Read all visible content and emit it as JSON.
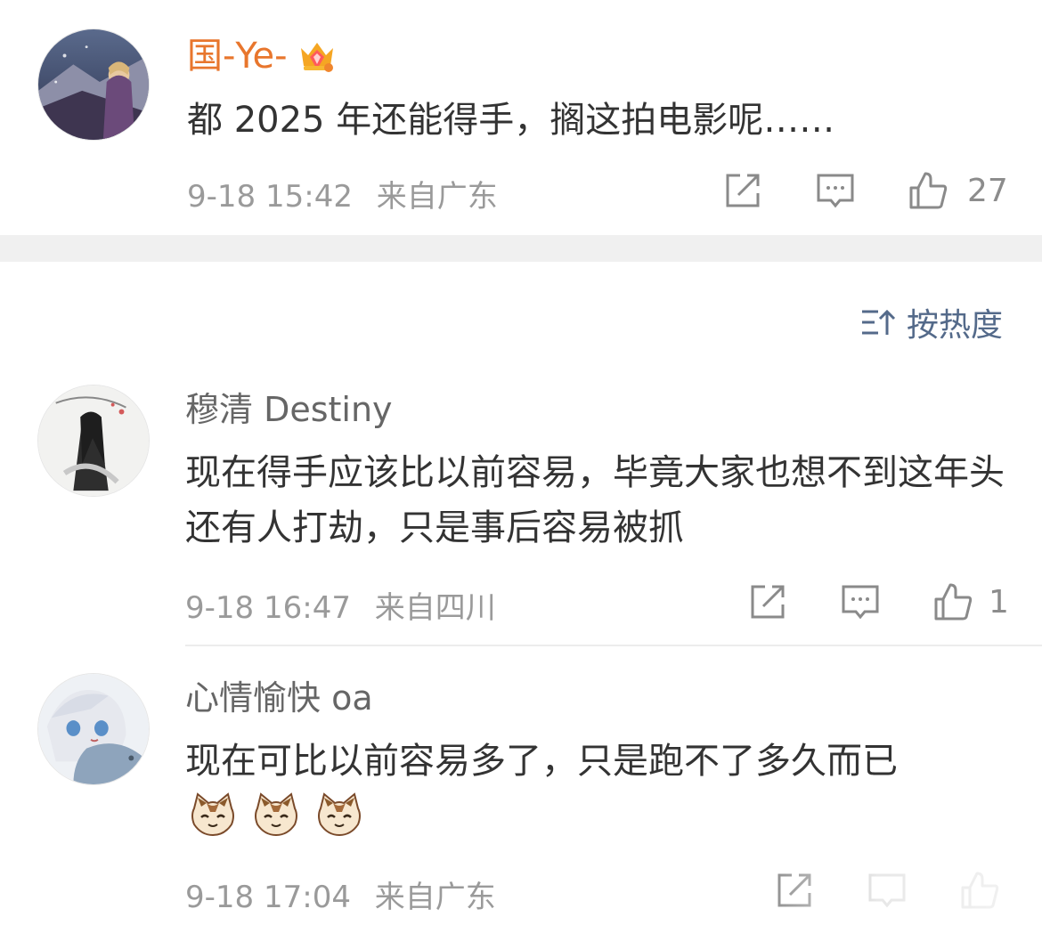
{
  "top_comment": {
    "username": "国-Ye-",
    "badge_icon": "crown-badge-icon",
    "text": "都 2025 年还能得手，搁这拍电影呢……",
    "time": "9-18 15:42",
    "location": "来自广东",
    "likes": "27",
    "username_color": "#e8762d"
  },
  "sort": {
    "label": "按热度",
    "icon": "sort-icon",
    "color": "#546a8a"
  },
  "replies": [
    {
      "username": "穆清 Destiny",
      "text": "现在得手应该比以前容易，毕竟大家也想不到这年头还有人打劫，只是事后容易被抓",
      "time": "9-18 16:47",
      "location": "来自四川",
      "likes": "1"
    },
    {
      "username": "心情愉快 oa",
      "text": "现在可比以前容易多了，只是跑不了多久而已",
      "emojis": [
        "cat-face-icon",
        "cat-face-icon",
        "cat-face-icon"
      ],
      "time": "9-18 17:04",
      "location": "来自广东",
      "likes": ""
    }
  ]
}
